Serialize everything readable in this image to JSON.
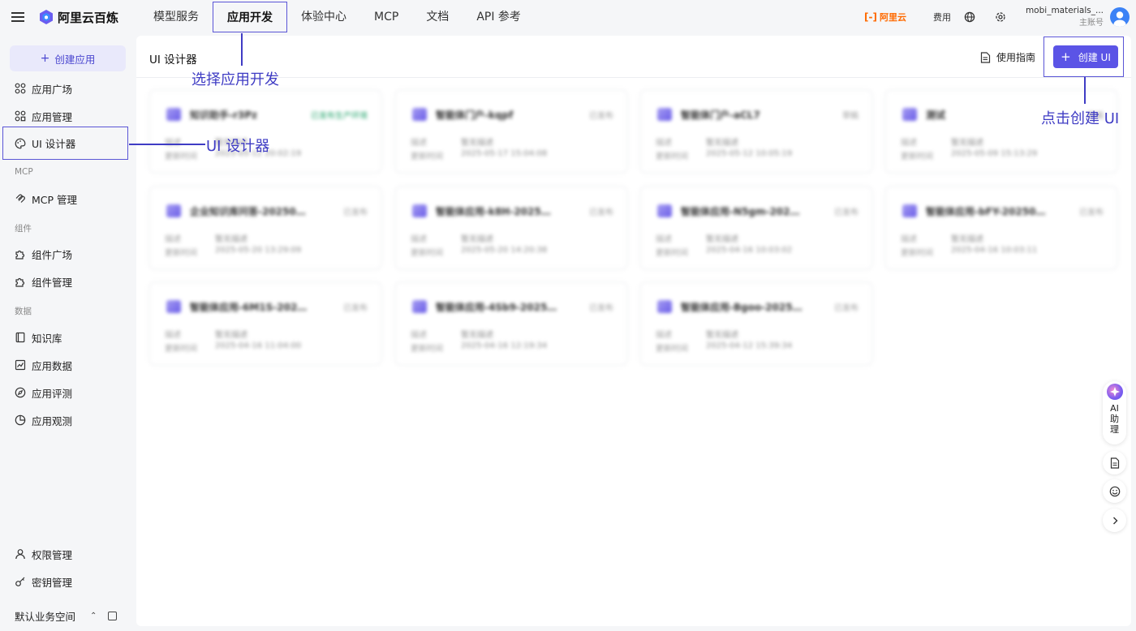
{
  "topbar": {
    "brand": "阿里云百炼",
    "nav": [
      "模型服务",
      "应用开发",
      "体验中心",
      "MCP",
      "文档",
      "API 参考"
    ],
    "active_nav": 1,
    "aliyun_logo_text": "阿里云",
    "fee_label": "费用",
    "account_name": "mobi_materials_...",
    "account_role": "主账号"
  },
  "sidebar": {
    "create_label": "创建应用",
    "items": [
      {
        "label": "应用广场",
        "icon": "grid-icon"
      },
      {
        "label": "应用管理",
        "icon": "grid-settings-icon"
      },
      {
        "label": "UI 设计器",
        "icon": "palette-icon"
      }
    ],
    "group_mcp": "MCP",
    "mcp_items": [
      {
        "label": "MCP 管理",
        "icon": "gear-icon"
      }
    ],
    "group_components": "组件",
    "component_items": [
      {
        "label": "组件广场",
        "icon": "puzzle-icon"
      },
      {
        "label": "组件管理",
        "icon": "puzzle-settings-icon"
      }
    ],
    "group_data": "数据",
    "data_items": [
      {
        "label": "知识库",
        "icon": "book-icon"
      },
      {
        "label": "应用数据",
        "icon": "chart-icon"
      },
      {
        "label": "应用评测",
        "icon": "compass-icon"
      },
      {
        "label": "应用观测",
        "icon": "pie-icon"
      }
    ],
    "bottom_items": [
      {
        "label": "权限管理",
        "icon": "user-icon"
      },
      {
        "label": "密钥管理",
        "icon": "key-icon"
      }
    ],
    "workspace": "默认业务空间"
  },
  "main": {
    "title": "UI 设计器",
    "guide_label": "使用指南",
    "create_ui_label": "创建 UI"
  },
  "cards": [
    {
      "name": "知识助手-r3Pz",
      "status": "已发布生产环境",
      "status_color": "#21a36a",
      "desc_label": "描述",
      "desc": "暂无描述",
      "time_label": "更新时间",
      "time": "2025-05-12 20:02:19"
    },
    {
      "name": "智能体门户-kqpf",
      "status": "已发布",
      "status_color": "#999999",
      "desc_label": "描述",
      "desc": "暂无描述",
      "time_label": "更新时间",
      "time": "2025-05-17 15:04:08"
    },
    {
      "name": "智能体门户-aCL7",
      "status": "草稿",
      "status_color": "#999999",
      "desc_label": "描述",
      "desc": "暂无描述",
      "time_label": "更新时间",
      "time": "2025-05-12 10:05:19"
    },
    {
      "name": "测试",
      "status": "草稿",
      "status_color": "#999999",
      "desc_label": "描述",
      "desc": "暂无描述",
      "time_label": "更新时间",
      "time": "2025-05-09 15:13:29"
    },
    {
      "name": "企业知识库问答-20250723...",
      "status": "已发布",
      "status_color": "#999999",
      "desc_label": "描述",
      "desc": "暂无描述",
      "time_label": "更新时间",
      "time": "2025-05-20 13:29:09"
    },
    {
      "name": "智能体应用-k8H-20250420...",
      "status": "已发布",
      "status_color": "#999999",
      "desc_label": "描述",
      "desc": "暂无描述",
      "time_label": "更新时间",
      "time": "2025-05-20 14:20:38"
    },
    {
      "name": "智能体应用-N5gm-202504...",
      "status": "已发布",
      "status_color": "#999999",
      "desc_label": "描述",
      "desc": "暂无描述",
      "time_label": "更新时间",
      "time": "2025-04-16 10:03:02"
    },
    {
      "name": "智能体应用-bFY-202504...",
      "status": "已发布",
      "status_color": "#999999",
      "desc_label": "描述",
      "desc": "暂无描述",
      "time_label": "更新时间",
      "time": "2025-04-16 10:03:11"
    },
    {
      "name": "智能体应用-6M1S-202504...",
      "status": "已发布",
      "status_color": "#999999",
      "desc_label": "描述",
      "desc": "暂无描述",
      "time_label": "更新时间",
      "time": "2025-04-16 11:04:00"
    },
    {
      "name": "智能体应用-4Sb9-202504...",
      "status": "已发布",
      "status_color": "#999999",
      "desc_label": "描述",
      "desc": "暂无描述",
      "time_label": "更新时间",
      "time": "2025-04-16 12:19:34"
    },
    {
      "name": "智能体应用-Bgoo-202504...",
      "status": "已发布",
      "status_color": "#999999",
      "desc_label": "描述",
      "desc": "暂无描述",
      "time_label": "更新时间",
      "time": "2025-04-12 15:39:34"
    }
  ],
  "annotations": {
    "select_app_dev": "选择应用开发",
    "ui_designer": "UI 设计器",
    "click_create_ui": "点击创建 UI"
  },
  "float": {
    "ai_label": "AI",
    "ai_label2": "助",
    "ai_label3": "理"
  },
  "colors": {
    "accent": "#5b54e6",
    "annotation": "#3f3cc4",
    "brand_orange": "#ff6a00"
  }
}
